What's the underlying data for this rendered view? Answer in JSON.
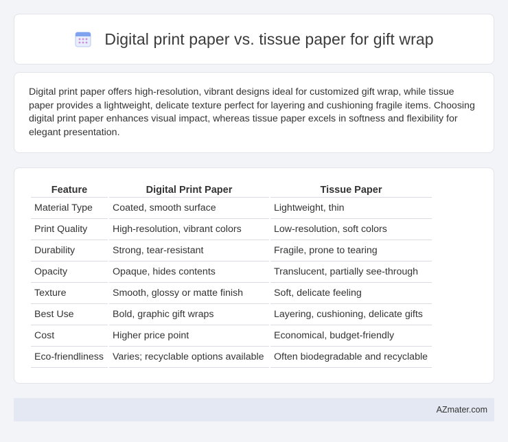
{
  "header": {
    "icon": "calendar-icon",
    "title": "Digital print paper vs. tissue paper for gift wrap"
  },
  "summary": {
    "text": "Digital print paper offers high-resolution, vibrant designs ideal for customized gift wrap, while tissue paper provides a lightweight, delicate texture perfect for layering and cushioning fragile items. Choosing digital print paper enhances visual impact, whereas tissue paper excels in softness and flexibility for elegant presentation."
  },
  "table": {
    "headers": [
      "Feature",
      "Digital Print Paper",
      "Tissue Paper"
    ],
    "rows": [
      [
        "Material Type",
        "Coated, smooth surface",
        "Lightweight, thin"
      ],
      [
        "Print Quality",
        "High-resolution, vibrant colors",
        "Low-resolution, soft colors"
      ],
      [
        "Durability",
        "Strong, tear-resistant",
        "Fragile, prone to tearing"
      ],
      [
        "Opacity",
        "Opaque, hides contents",
        "Translucent, partially see-through"
      ],
      [
        "Texture",
        "Smooth, glossy or matte finish",
        "Soft, delicate feeling"
      ],
      [
        "Best Use",
        "Bold, graphic gift wraps",
        "Layering, cushioning, delicate gifts"
      ],
      [
        "Cost",
        "Higher price point",
        "Economical, budget-friendly"
      ],
      [
        "Eco-friendliness",
        "Varies; recyclable options available",
        "Often biodegradable and recyclable"
      ]
    ]
  },
  "footer": {
    "site": "AZmater.com"
  },
  "colors": {
    "background": "#f3f4f8",
    "card": "#ffffff",
    "footer_bg": "#e3e8f3",
    "icon_accent": "#5b8def",
    "icon_dots": "#c98fd6"
  }
}
